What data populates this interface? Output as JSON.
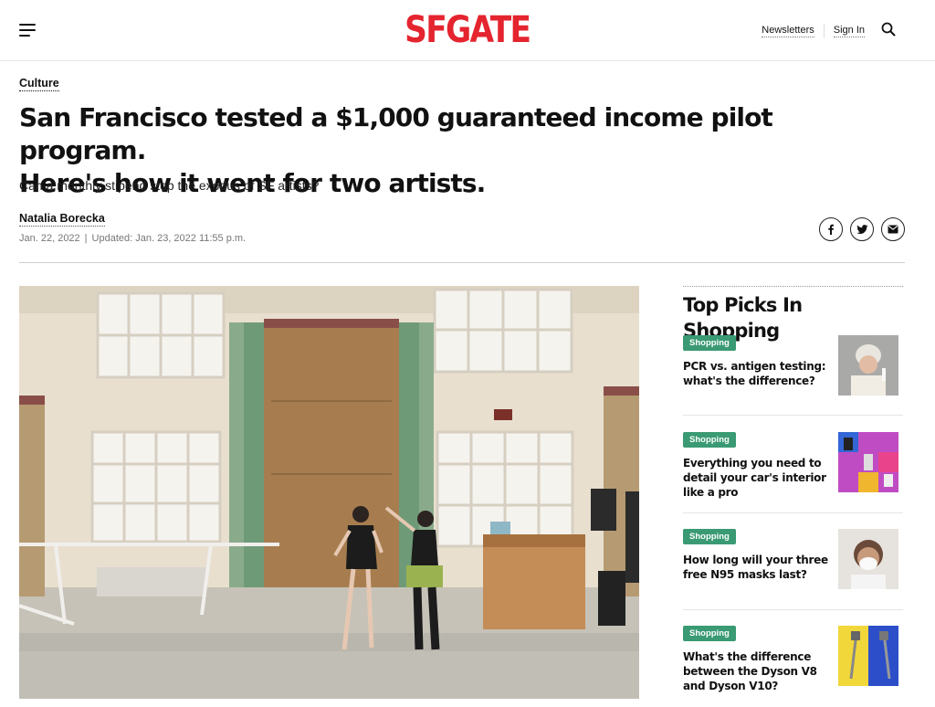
{
  "header": {
    "logo": "SFGATE",
    "newsletters_label": "Newsletters",
    "signin_label": "Sign In"
  },
  "article": {
    "category": "Culture",
    "headline_line1": "San Francisco tested a $1,000 guaranteed income pilot program.",
    "headline_line2": "Here's how it went for two artists.",
    "dek": "Can a monthly stipend stop the exodus of SF artists?",
    "author": "Natalia Borecka",
    "published": "Jan. 22, 2022",
    "separator": "|",
    "updated": "Updated: Jan. 23, 2022 11:55 p.m."
  },
  "share": {
    "icons": [
      "facebook-icon",
      "twitter-icon",
      "email-icon"
    ]
  },
  "sidebar": {
    "title": "Top Picks In Shopping",
    "items": [
      {
        "badge": "Shopping",
        "title": "PCR vs. antigen testing: what's the difference?"
      },
      {
        "badge": "Shopping",
        "title": "Everything you need to detail your car's interior like a pro"
      },
      {
        "badge": "Shopping",
        "title": "How long will your three free N95 masks last?"
      },
      {
        "badge": "Shopping",
        "title": "What's the difference between the Dyson V8 and Dyson V10?"
      }
    ]
  },
  "colors": {
    "brand": "#e4242f",
    "badge": "#3a9a73"
  }
}
